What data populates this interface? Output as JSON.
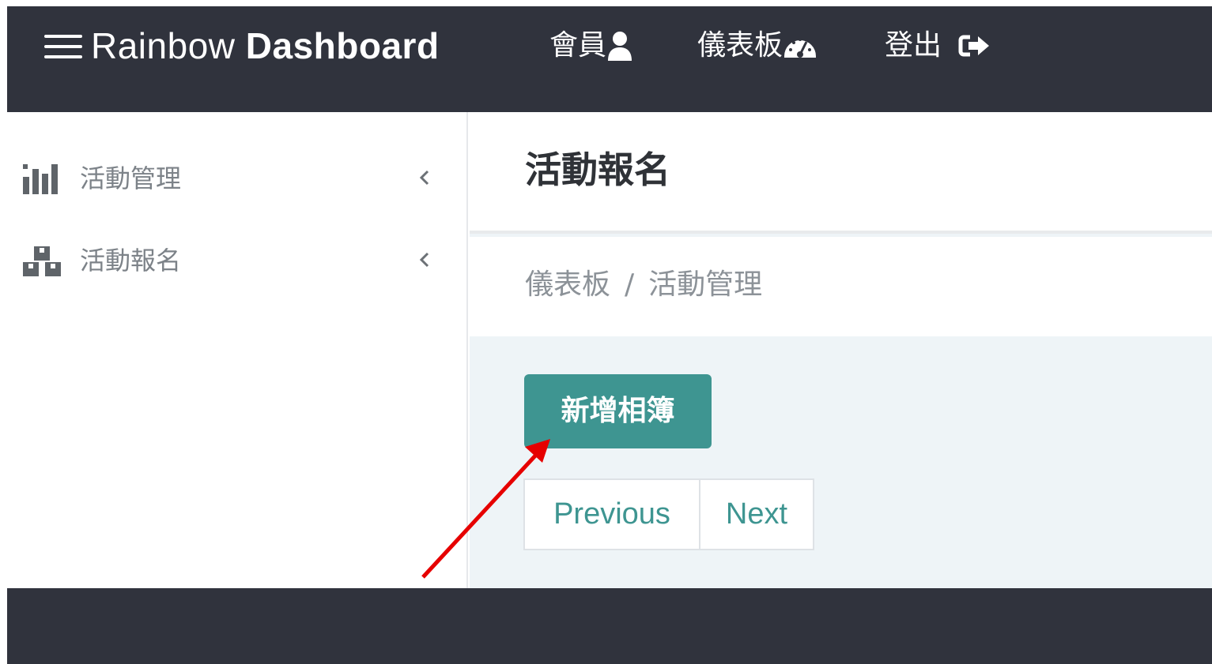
{
  "app": {
    "brand_light": "Rainbow ",
    "brand_bold": "Dashboard"
  },
  "topnav": {
    "members_label": "會員",
    "dashboard_label": "儀表板",
    "logout_label": "登出"
  },
  "sidebar": {
    "items": [
      {
        "label": "活動管理",
        "icon": "bar-chart-icon"
      },
      {
        "label": "活動報名",
        "icon": "cubes-icon"
      }
    ]
  },
  "main": {
    "title": "活動報名",
    "breadcrumb": [
      "儀表板",
      "活動管理"
    ],
    "breadcrumb_separator": "/",
    "add_button_label": "新增相簿",
    "pagination": {
      "previous_label": "Previous",
      "next_label": "Next"
    }
  },
  "colors": {
    "nav_bg": "#30333d",
    "accent": "#3e9591",
    "content_bg": "#eef4f7",
    "annotation_arrow": "#e60000"
  }
}
